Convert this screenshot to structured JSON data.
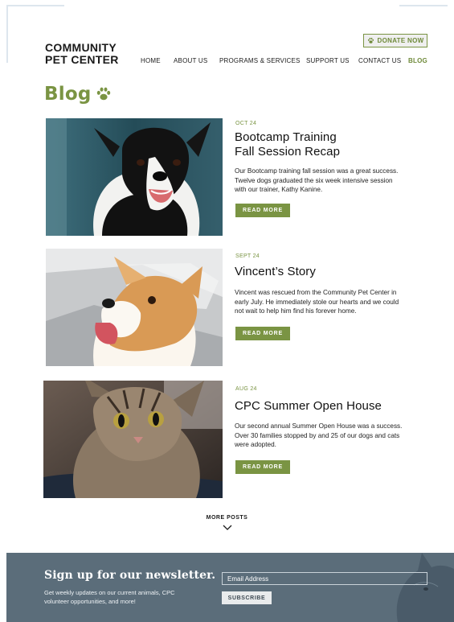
{
  "header": {
    "logo_line1": "COMMUNITY",
    "logo_line2": "PET CENTER",
    "donate_label": "DONATE NOW",
    "nav": [
      "HOME",
      "ABOUT US",
      "PROGRAMS & SERVICES",
      "SUPPORT US",
      "CONTACT US",
      "BLOG"
    ],
    "active_nav": "BLOG"
  },
  "page": {
    "title": "Blog",
    "title_icon": "paw-icon"
  },
  "posts": [
    {
      "date": "OCT 24",
      "title_line1": "Bootcamp Training",
      "title_line2": "Fall Session Recap",
      "excerpt": "Our Bootcamp training fall session was a great success. Twelve dogs graduated the six week intensive session with our trainer, Kathy Kanine.",
      "button": "READ MORE",
      "image": "border-collie-photo"
    },
    {
      "date": "SEPT 24",
      "title_line1": "Vincent’s Story",
      "title_line2": "",
      "excerpt": "Vincent was rescued from the Community Pet Center in early July. He immediately stole our hearts and we could not wait to help him find his forever home.",
      "button": "READ MORE",
      "image": "corgi-photo"
    },
    {
      "date": "AUG 24",
      "title_line1": "CPC Summer Open House",
      "title_line2": "",
      "excerpt": "Our second annual Summer Open House was a success. Over 30 families stopped by and 25 of our dogs and cats were adopted.",
      "button": "READ MORE",
      "image": "tabby-cat-photo"
    }
  ],
  "more_posts": {
    "label": "MORE POSTS",
    "icon": "chevron-down-icon"
  },
  "newsletter": {
    "heading": "Sign up for our newsletter.",
    "subtext": "Get weekly updates on our current animals, CPC volunteer opportunities, and more!",
    "email_placeholder": "Email Address",
    "subscribe_label": "SUBSCRIBE"
  },
  "colors": {
    "accent_green": "#7a9443",
    "newsletter_bg": "#5b6d7a"
  }
}
